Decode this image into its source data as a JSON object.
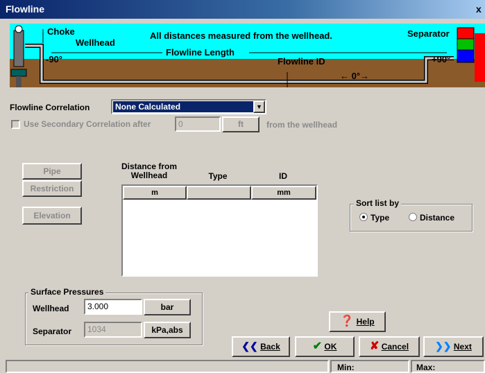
{
  "window": {
    "title": "Flowline",
    "close_glyph": "x"
  },
  "banner": {
    "choke": "Choke",
    "wellhead": "Wellhead",
    "note": "All distances measured from the wellhead.",
    "separator": "Separator",
    "flowline_length": "Flowline Length",
    "flowline_id": "Flowline ID",
    "angle_left": "-90°",
    "angle_mid": "← 0°→",
    "angle_right": "+90°"
  },
  "correlation": {
    "label": "Flowline Correlation",
    "selected": "None Calculated",
    "secondary_label": "Use Secondary Correlation after",
    "secondary_value": "0",
    "secondary_unit": "ft",
    "secondary_suffix": "from the wellhead"
  },
  "side_buttons": {
    "pipe": "Pipe",
    "restriction": "Restriction",
    "elevation": "Elevation"
  },
  "table": {
    "headers": {
      "distance": "Distance from\nWellhead",
      "type": "Type",
      "id": "ID"
    },
    "units": {
      "distance": "m",
      "type": "",
      "id": "mm"
    },
    "rows": []
  },
  "sort": {
    "legend": "Sort list by",
    "type": "Type",
    "distance": "Distance",
    "selected": "Type"
  },
  "pressures": {
    "legend": "Surface Pressures",
    "wellhead_label": "Wellhead",
    "wellhead_value": "3.000",
    "wellhead_unit": "bar",
    "separator_label": "Separator",
    "separator_value": "1034",
    "separator_unit": "kPa,abs"
  },
  "buttons": {
    "help": "Help",
    "back": "Back",
    "ok": "OK",
    "cancel": "Cancel",
    "next": "Next"
  },
  "status": {
    "min": "Min:",
    "max": "Max:"
  }
}
